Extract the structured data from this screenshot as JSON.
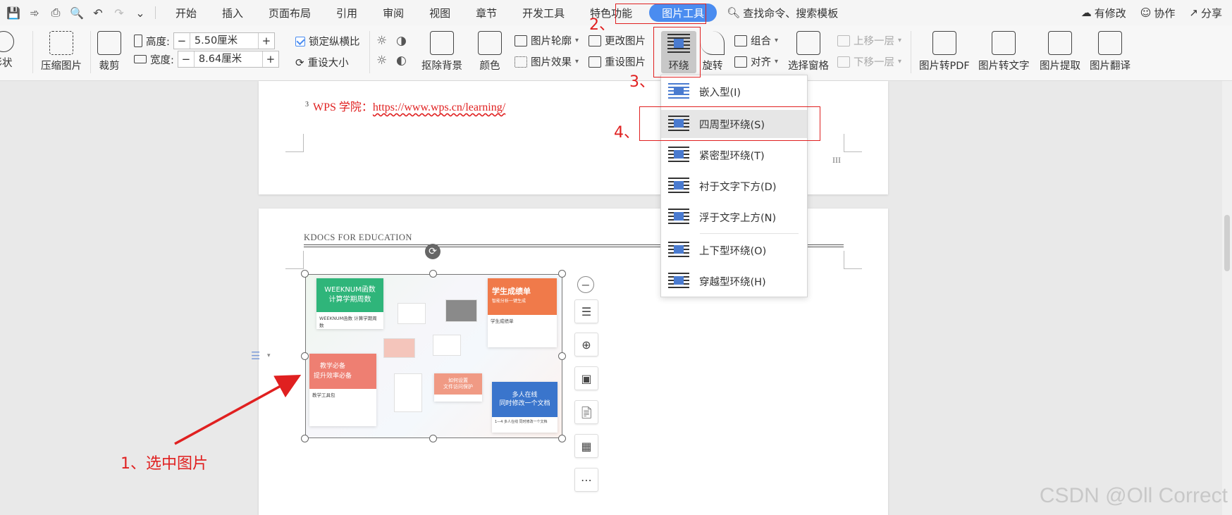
{
  "menubar": {
    "tabs": [
      "开始",
      "插入",
      "页面布局",
      "引用",
      "审阅",
      "视图",
      "章节",
      "开发工具",
      "特色功能",
      "图片工具"
    ],
    "active_tab": "图片工具",
    "search": "查找命令、搜索模板",
    "right": [
      "有修改",
      "协作",
      "分享"
    ]
  },
  "ribbon": {
    "shape": "形状",
    "compress": "压缩图片",
    "crop": "裁剪",
    "height_label": "高度:",
    "height_value": "5.50厘米",
    "width_label": "宽度:",
    "width_value": "8.64厘米",
    "lock_ratio": "锁定纵横比",
    "reset_size": "重设大小",
    "remove_bg": "抠除背景",
    "color": "颜色",
    "outline": "图片轮廓",
    "effect": "图片效果",
    "change_pic": "更改图片",
    "reset_pic": "重设图片",
    "wrap": "环绕",
    "rotate": "旋转",
    "group": "组合",
    "align": "对齐",
    "select_pane": "选择窗格",
    "bring_forward": "上移一层",
    "send_backward": "下移一层",
    "to_pdf": "图片转PDF",
    "to_text": "图片转文字",
    "extract": "图片提取",
    "translate": "图片翻译"
  },
  "document": {
    "footnote_num": "3",
    "footnote_label": "WPS 学院：",
    "footnote_url": "https://www.wps.cn/learning/",
    "page_roman": "III",
    "header": "KDOCS FOR EDUCATION"
  },
  "image_cards": {
    "c1_title": "WEEKNUM函数\n计算学期周数",
    "c1_text": "WEEKNUM函数 计算学期周数",
    "c2_title": "学生成绩单",
    "c2_sub": "智能分析一键生成",
    "c2_text": "学生成绩单",
    "c3_title": "教学必备\n提升效率必备",
    "c3_text": "教学工具包",
    "c4_title": "多人在线\n同时修改一个文档",
    "c4_text": "1—4 多人在线 同时修改一个文档",
    "c5_title": "如何设置\n文件访问保护"
  },
  "wrap_menu": {
    "items": [
      "嵌入型(I)",
      "四周型环绕(S)",
      "紧密型环绕(T)",
      "衬于文字下方(D)",
      "浮于文字上方(N)",
      "上下型环绕(O)",
      "穿越型环绕(H)"
    ],
    "highlighted": "四周型环绕(S)"
  },
  "annotations": {
    "step1": "1、选中图片",
    "step2": "2、",
    "step3": "3、",
    "step4": "4、"
  },
  "watermark": "CSDN @Oll Correct",
  "colors": {
    "accent": "#4a8cf0",
    "annotation": "#e02020"
  }
}
